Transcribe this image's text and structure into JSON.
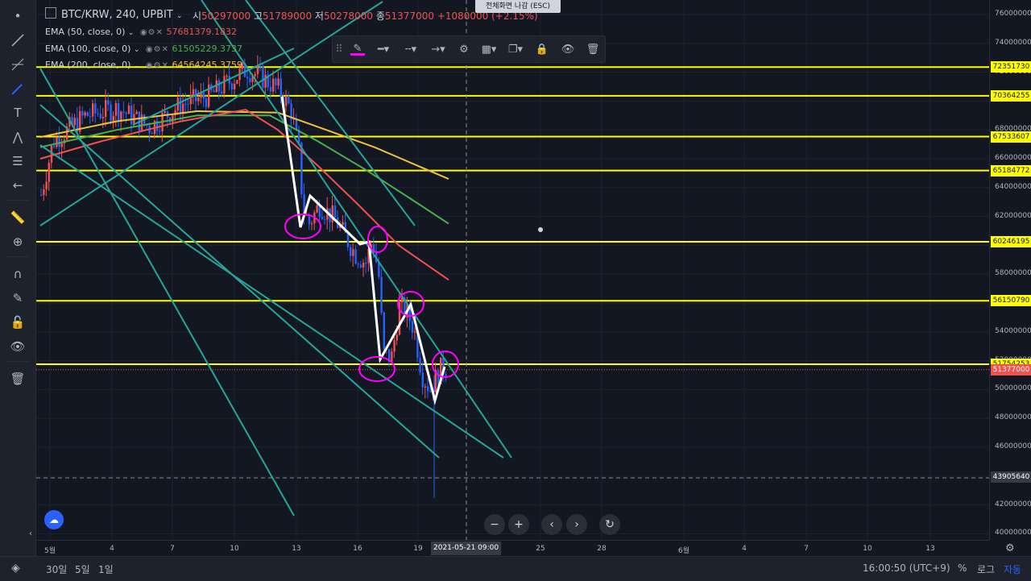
{
  "header": {
    "symbol_title": "BTC/KRW, 240, UPBIT",
    "ohlc": {
      "open_label": "시",
      "open": "50297000",
      "high_label": "고",
      "high": "51789000",
      "low_label": "저",
      "low": "50278000",
      "close_label": "종",
      "close": "51377000",
      "change": "+1080000 (+2.15%)"
    },
    "esc_hint": "전체화면 나감 (ESC)"
  },
  "indicators": [
    {
      "label": "EMA (50, close, 0)",
      "value": "57681379.1832",
      "color": "#ef5350"
    },
    {
      "label": "EMA (100, close, 0)",
      "value": "61505229.3737",
      "color": "#4caf50"
    },
    {
      "label": "EMA (200, close, 0)",
      "value": "64564245.3759",
      "color": "#f0c040"
    }
  ],
  "price_axis": {
    "ticks": [
      "76000000",
      "74000000",
      "72000000",
      "70000000",
      "68000000",
      "66000000",
      "64000000",
      "62000000",
      "60000000",
      "58000000",
      "56000000",
      "54000000",
      "52000000",
      "50000000",
      "48000000",
      "46000000",
      "44000000",
      "42000000",
      "40000000"
    ],
    "levels": [
      {
        "price": "72351730"
      },
      {
        "price": "70364255"
      },
      {
        "price": "67533607"
      },
      {
        "price": "65184772"
      },
      {
        "price": "60246195"
      },
      {
        "price": "56150790"
      },
      {
        "price": "51754253"
      }
    ],
    "last_price": "51377000",
    "dashed_level": "43905640",
    "level_color": "#ffff00"
  },
  "time_axis": {
    "ticks": [
      "5월",
      "4",
      "7",
      "10",
      "13",
      "16",
      "19",
      "25",
      "28",
      "6월",
      "4",
      "7",
      "10",
      "13"
    ],
    "cursor_label": "2021-05-21",
    "cursor_time": "09:00"
  },
  "bottom_bar": {
    "ranges": [
      "30일",
      "5일",
      "1일"
    ],
    "clock": "16:00:50 (UTC+9)",
    "percent": "%",
    "log": "로그",
    "auto": "자동"
  },
  "nav": {
    "zoom_out": "−",
    "zoom_in": "+",
    "scroll_left": "‹",
    "scroll_right": "›",
    "reset": "↻"
  },
  "colors": {
    "background": "#131722",
    "up": "#ef5350",
    "down": "#2962ff",
    "trendline": "#26a69a",
    "annotation": "#ff00ff"
  }
}
